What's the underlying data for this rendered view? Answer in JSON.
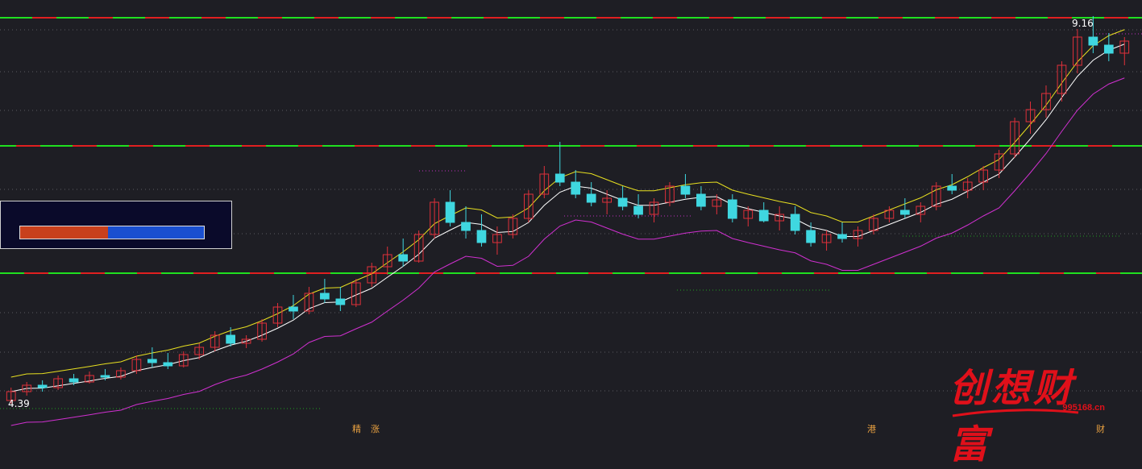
{
  "price_labels": {
    "high": "9.16",
    "low": "4.39"
  },
  "bottom_markers": [
    "精",
    "涨",
    "港",
    "财"
  ],
  "watermark": {
    "brand": "创想财富",
    "site": "995168.cn"
  },
  "panel": {
    "ratio_red": 0.48
  },
  "colors": {
    "background": "#1e1e24",
    "up": "#e0303a",
    "down": "#3fd7e0",
    "ma_white": "#ffffff",
    "upper_band": "#e8e020",
    "lower_band": "#d030d0",
    "green_label": "#20d020",
    "red_label": "#e02020",
    "white_label": "#ffffff"
  },
  "chart_data": {
    "type": "candlestick",
    "price_range": [
      4.39,
      9.16
    ],
    "candles": [
      [
        4.39,
        4.55,
        4.35,
        4.5
      ],
      [
        4.5,
        4.62,
        4.45,
        4.58
      ],
      [
        4.58,
        4.64,
        4.5,
        4.55
      ],
      [
        4.55,
        4.7,
        4.52,
        4.66
      ],
      [
        4.66,
        4.72,
        4.58,
        4.62
      ],
      [
        4.62,
        4.75,
        4.6,
        4.7
      ],
      [
        4.7,
        4.78,
        4.64,
        4.68
      ],
      [
        4.68,
        4.8,
        4.65,
        4.76
      ],
      [
        4.76,
        4.95,
        4.72,
        4.9
      ],
      [
        4.9,
        5.05,
        4.8,
        4.86
      ],
      [
        4.86,
        4.98,
        4.78,
        4.82
      ],
      [
        4.82,
        5.0,
        4.8,
        4.96
      ],
      [
        4.96,
        5.1,
        4.9,
        5.05
      ],
      [
        5.05,
        5.25,
        5.0,
        5.2
      ],
      [
        5.2,
        5.3,
        5.06,
        5.1
      ],
      [
        5.1,
        5.2,
        5.04,
        5.15
      ],
      [
        5.15,
        5.4,
        5.12,
        5.35
      ],
      [
        5.35,
        5.6,
        5.3,
        5.55
      ],
      [
        5.55,
        5.7,
        5.4,
        5.5
      ],
      [
        5.5,
        5.8,
        5.46,
        5.72
      ],
      [
        5.72,
        5.9,
        5.6,
        5.65
      ],
      [
        5.65,
        5.8,
        5.5,
        5.58
      ],
      [
        5.58,
        5.9,
        5.55,
        5.85
      ],
      [
        5.85,
        6.1,
        5.8,
        6.05
      ],
      [
        6.05,
        6.3,
        5.95,
        6.2
      ],
      [
        6.2,
        6.4,
        6.05,
        6.12
      ],
      [
        6.12,
        6.5,
        6.1,
        6.45
      ],
      [
        6.45,
        6.9,
        6.4,
        6.85
      ],
      [
        6.85,
        7.0,
        6.55,
        6.6
      ],
      [
        6.6,
        6.8,
        6.4,
        6.5
      ],
      [
        6.5,
        6.7,
        6.3,
        6.35
      ],
      [
        6.35,
        6.55,
        6.2,
        6.45
      ],
      [
        6.45,
        6.7,
        6.4,
        6.65
      ],
      [
        6.65,
        7.0,
        6.6,
        6.95
      ],
      [
        6.95,
        7.3,
        6.9,
        7.2
      ],
      [
        7.2,
        7.6,
        7.05,
        7.1
      ],
      [
        7.1,
        7.25,
        6.9,
        6.95
      ],
      [
        6.95,
        7.1,
        6.8,
        6.85
      ],
      [
        6.85,
        7.0,
        6.7,
        6.9
      ],
      [
        6.9,
        7.05,
        6.75,
        6.8
      ],
      [
        6.8,
        6.95,
        6.65,
        6.7
      ],
      [
        6.7,
        6.9,
        6.6,
        6.85
      ],
      [
        6.85,
        7.1,
        6.8,
        7.05
      ],
      [
        7.05,
        7.2,
        6.9,
        6.95
      ],
      [
        6.95,
        7.05,
        6.75,
        6.8
      ],
      [
        6.8,
        6.95,
        6.7,
        6.88
      ],
      [
        6.88,
        6.95,
        6.6,
        6.65
      ],
      [
        6.65,
        6.8,
        6.55,
        6.75
      ],
      [
        6.75,
        6.85,
        6.6,
        6.62
      ],
      [
        6.62,
        6.8,
        6.5,
        6.7
      ],
      [
        6.7,
        6.8,
        6.45,
        6.5
      ],
      [
        6.5,
        6.6,
        6.3,
        6.35
      ],
      [
        6.35,
        6.5,
        6.25,
        6.45
      ],
      [
        6.45,
        6.6,
        6.35,
        6.4
      ],
      [
        6.4,
        6.55,
        6.3,
        6.5
      ],
      [
        6.5,
        6.7,
        6.45,
        6.65
      ],
      [
        6.65,
        6.8,
        6.6,
        6.75
      ],
      [
        6.75,
        6.9,
        6.65,
        6.7
      ],
      [
        6.7,
        6.85,
        6.6,
        6.8
      ],
      [
        6.8,
        7.1,
        6.75,
        7.05
      ],
      [
        7.05,
        7.2,
        6.95,
        7.0
      ],
      [
        7.0,
        7.15,
        6.9,
        7.1
      ],
      [
        7.1,
        7.3,
        7.0,
        7.25
      ],
      [
        7.25,
        7.5,
        7.15,
        7.45
      ],
      [
        7.45,
        7.9,
        7.4,
        7.85
      ],
      [
        7.85,
        8.1,
        7.7,
        8.0
      ],
      [
        8.0,
        8.3,
        7.9,
        8.2
      ],
      [
        8.2,
        8.6,
        8.1,
        8.55
      ],
      [
        8.55,
        9.0,
        8.45,
        8.9
      ],
      [
        8.9,
        9.16,
        8.7,
        8.8
      ],
      [
        8.8,
        8.95,
        8.6,
        8.7
      ],
      [
        8.7,
        8.9,
        8.55,
        8.85
      ]
    ]
  }
}
